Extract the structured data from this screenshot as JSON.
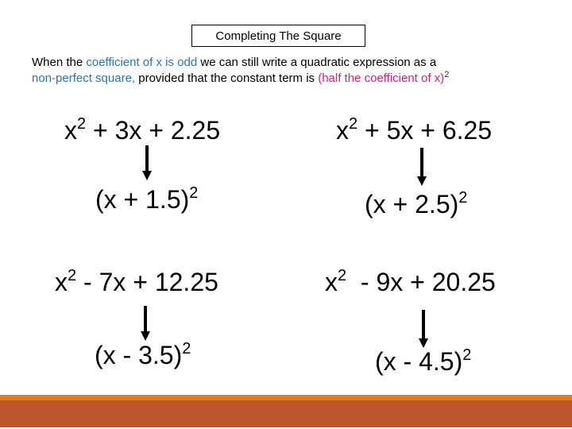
{
  "title": "Completing The Square",
  "intro": {
    "line1": [
      {
        "text": "When the ",
        "style": "plain"
      },
      {
        "text": "coefficient of x is odd",
        "style": "blue"
      },
      {
        "text": " we can still write a quadratic expression as a",
        "style": "plain"
      }
    ],
    "line2": [
      {
        "text": "non-perfect square,",
        "style": "blue"
      },
      {
        "text": " provided that the constant term is ",
        "style": "plain"
      },
      {
        "text": "(half the coefficient of x)",
        "style": "pink"
      },
      {
        "text": "2",
        "style": "sup"
      }
    ]
  },
  "examples": [
    {
      "quadratic": {
        "base": "x",
        "exp": "2",
        "rest": " + 3x + 2.25"
      },
      "square": {
        "base": "(x + 1.5)",
        "exp": "2"
      }
    },
    {
      "quadratic": {
        "base": "x",
        "exp": "2",
        "rest": " + 5x + 6.25"
      },
      "square": {
        "base": "(x + 2.5)",
        "exp": "2"
      }
    },
    {
      "quadratic": {
        "base": "x",
        "exp": "2",
        "rest": " - 7x + 12.25"
      },
      "square": {
        "base": "(x - 3.5)",
        "exp": "2"
      }
    },
    {
      "quadratic": {
        "base": "x",
        "exp": "2",
        "rest": "  - 9x + 20.25"
      },
      "square": {
        "base": "(x - 4.5)",
        "exp": "2"
      }
    }
  ],
  "colors": {
    "highlight_blue": "#2e74b5",
    "highlight_pink": "#d6207a",
    "footer_stripe": "#e07f18",
    "footer_bar": "#be582c"
  }
}
